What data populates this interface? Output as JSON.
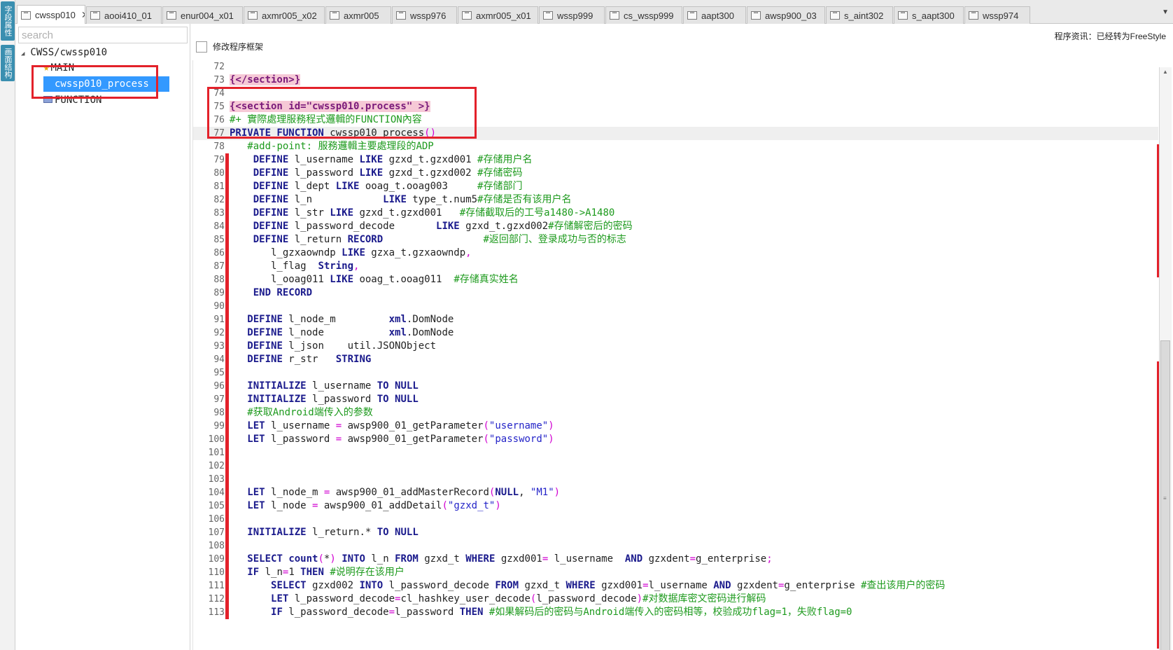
{
  "side_tabs": [
    "字段属性",
    "画面结构"
  ],
  "tabs": [
    {
      "label": "cwssp010",
      "active": true
    },
    {
      "label": "aooi410_01"
    },
    {
      "label": "enur004_x01"
    },
    {
      "label": "axmr005_x02"
    },
    {
      "label": "axmr005"
    },
    {
      "label": "wssp976"
    },
    {
      "label": "axmr005_x01"
    },
    {
      "label": "wssp999"
    },
    {
      "label": "cs_wssp999"
    },
    {
      "label": "aapt300"
    },
    {
      "label": "awsp900_03"
    },
    {
      "label": "s_aint302"
    },
    {
      "label": "s_aapt300"
    },
    {
      "label": "wssp974"
    }
  ],
  "tab_close": "✕",
  "tab_dropdown": "▼",
  "search": {
    "placeholder": "search"
  },
  "tree": {
    "root": "CWSS/cwssp010",
    "main": "MAIN",
    "process": "cwssp010_process",
    "function": "FUNCTION"
  },
  "modify_frame_label": "修改程序框架",
  "program_info": "程序资讯：已经转为FreeStyle",
  "colors": {
    "accent": "#3399ff",
    "highlight_box": "#e3212a"
  }
}
